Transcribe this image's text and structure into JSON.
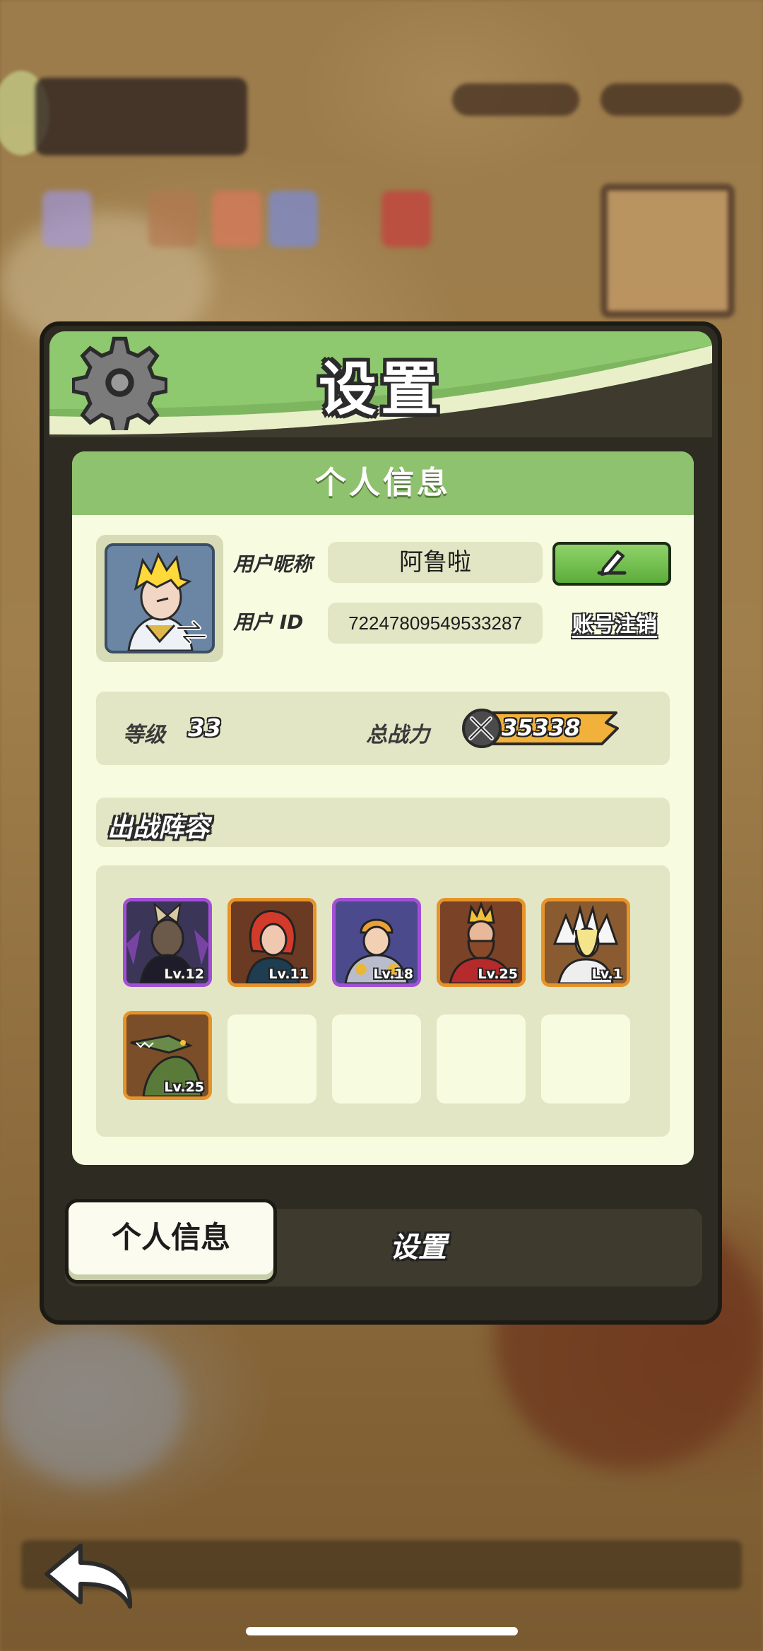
{
  "dialog": {
    "title": "设置",
    "section_title": "个人信息"
  },
  "profile": {
    "nickname_label": "用户昵称",
    "nickname": "阿鲁啦",
    "id_label": "用户 ID",
    "user_id": "7224780954953328‌7",
    "deregister_label": "账号注销",
    "level_label": "等级",
    "level": "33",
    "power_label": "总战力",
    "power": "35338"
  },
  "team": {
    "title": "出战阵容",
    "heroes": [
      {
        "level": "Lv.12",
        "rarity": "epic"
      },
      {
        "level": "Lv.11",
        "rarity": "legendary"
      },
      {
        "level": "Lv.18",
        "rarity": "epic"
      },
      {
        "level": "Lv.25",
        "rarity": "legendary"
      },
      {
        "level": "Lv.1",
        "rarity": "legendary"
      },
      {
        "level": "Lv.25",
        "rarity": "legendary"
      }
    ],
    "empty_slots": 4
  },
  "tabs": {
    "active": "个人信息",
    "inactive": "设置"
  },
  "colors": {
    "header_green": "#7eb660",
    "panel_cream": "#f7fbdf",
    "epic_border": "#a24fd6",
    "legendary_border": "#e6932a",
    "power_bar": "#f2b13a"
  }
}
